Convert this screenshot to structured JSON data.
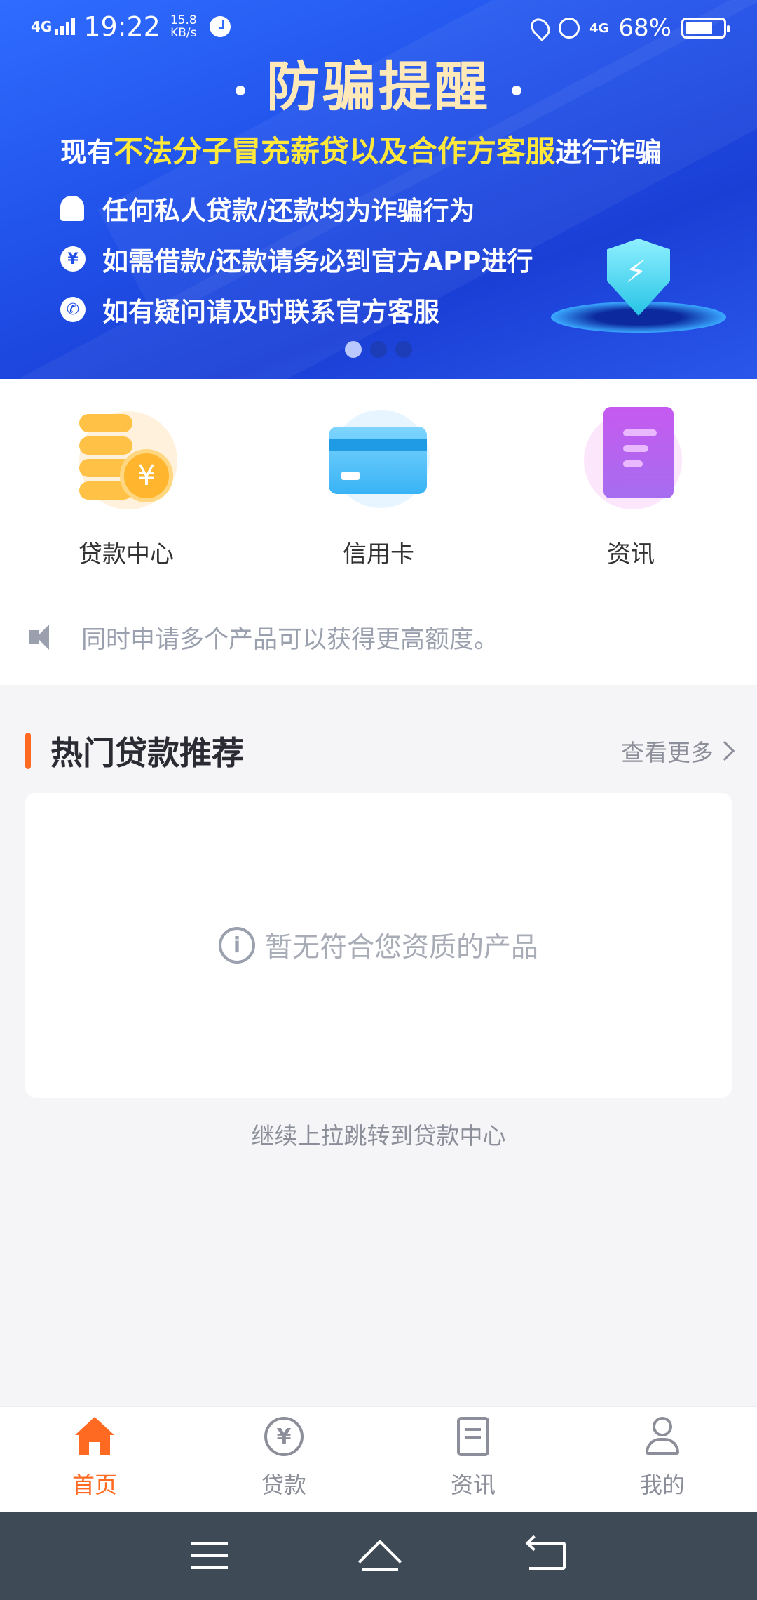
{
  "status_bar": {
    "network": "4G",
    "time": "19:22",
    "speed_value": "15.8",
    "speed_unit": "KB/s",
    "network_right": "4G",
    "battery_percent": "68%",
    "battery_level": 0.68
  },
  "banner": {
    "title": "防骗提醒",
    "subtitle_prefix": "现有",
    "subtitle_highlight": "不法分子冒充薪贷以及合作方客服",
    "subtitle_suffix": "进行诈骗",
    "lines": [
      {
        "icon": "bell-icon",
        "text": "任何私人贷款/还款均为诈骗行为"
      },
      {
        "icon": "yen-icon",
        "glyph": "¥",
        "text": "如需借款/还款请务必到官方APP进行"
      },
      {
        "icon": "phone-icon",
        "glyph": "✆",
        "text": "如有疑问请及时联系官方客服"
      }
    ],
    "pager": {
      "count": 3,
      "active_index": 0
    }
  },
  "quick_entries": [
    {
      "label": "贷款中心",
      "icon": "loan-coins-icon"
    },
    {
      "label": "信用卡",
      "icon": "credit-card-icon"
    },
    {
      "label": "资讯",
      "icon": "news-document-icon"
    }
  ],
  "notice": {
    "text": "同时申请多个产品可以获得更高额度。",
    "icon": "speaker-icon"
  },
  "hot_section": {
    "title": "热门贷款推荐",
    "more_label": "查看更多",
    "empty_text": "暂无符合您资质的产品",
    "pull_hint": "继续上拉跳转到贷款中心"
  },
  "tabbar": {
    "items": [
      {
        "label": "首页",
        "icon": "home-icon",
        "active": true
      },
      {
        "label": "贷款",
        "icon": "yen-circle-icon",
        "active": false
      },
      {
        "label": "资讯",
        "icon": "document-icon",
        "active": false
      },
      {
        "label": "我的",
        "icon": "user-icon",
        "active": false
      }
    ]
  },
  "colors": {
    "accent": "#ff6a23",
    "banner_blue": "#1f4ee6",
    "highlight_yellow": "#ffe83a",
    "muted_text": "#8c8f99",
    "nav_bar": "#3f4a57"
  }
}
